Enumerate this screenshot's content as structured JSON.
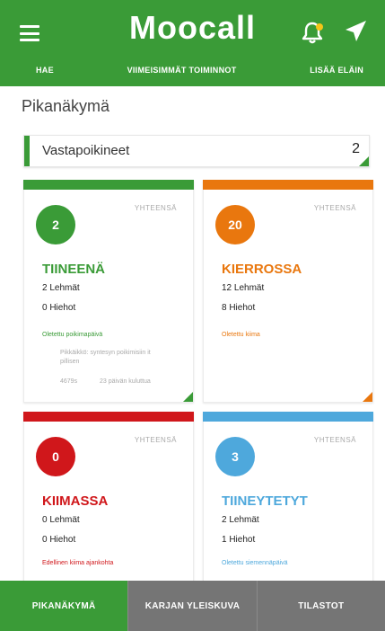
{
  "app": {
    "title": "Moocall"
  },
  "nav": {
    "links": [
      "HAE",
      "VIIMEISIMMÄT TOIMINNOT",
      "LISÄÄ ELÄIN"
    ]
  },
  "page": {
    "title": "Pikanäkymä"
  },
  "summary": {
    "label": "Vastapoikineet",
    "count": "2"
  },
  "cards": [
    {
      "count": "2",
      "total_label": "YHTEENSÄ",
      "title": "TIINEENÄ",
      "line1": "2 Lehmät",
      "line2": "0 Hiehot",
      "sub": "Oletettu poikimapäivä",
      "note": "Pikkäikkö: syntesyn poikimisiin it pillisen",
      "foot1": "4679s",
      "foot2": "23 päivän kuluttua",
      "color": "#3a9b37"
    },
    {
      "count": "20",
      "total_label": "YHTEENSÄ",
      "title": "KIERROSSA",
      "line1": "12 Lehmät",
      "line2": "8 Hiehot",
      "sub": "Oletettu kiima",
      "color": "#e9770e"
    },
    {
      "count": "0",
      "total_label": "YHTEENSÄ",
      "title": "KIIMASSA",
      "line1": "0 Lehmät",
      "line2": "0 Hiehot",
      "sub": "Edellinen kiima ajankohta",
      "color": "#d0171b"
    },
    {
      "count": "3",
      "total_label": "YHTEENSÄ",
      "title": "TIINEYTETYT",
      "line1": "2 Lehmät",
      "line2": "1 Hiehot",
      "sub": "Oletettu siemennäpäivä",
      "color": "#4ea8dc"
    }
  ],
  "tabs": [
    "PIKANÄKYMÄ",
    "KARJAN YLEISKUVA",
    "TILASTOT"
  ],
  "colors": {
    "brand": "#3a9b37",
    "bell_dot": "#f5c518",
    "tab_inactive": "#757575"
  },
  "icons": [
    "menu-icon",
    "bell-icon",
    "plane-icon"
  ]
}
